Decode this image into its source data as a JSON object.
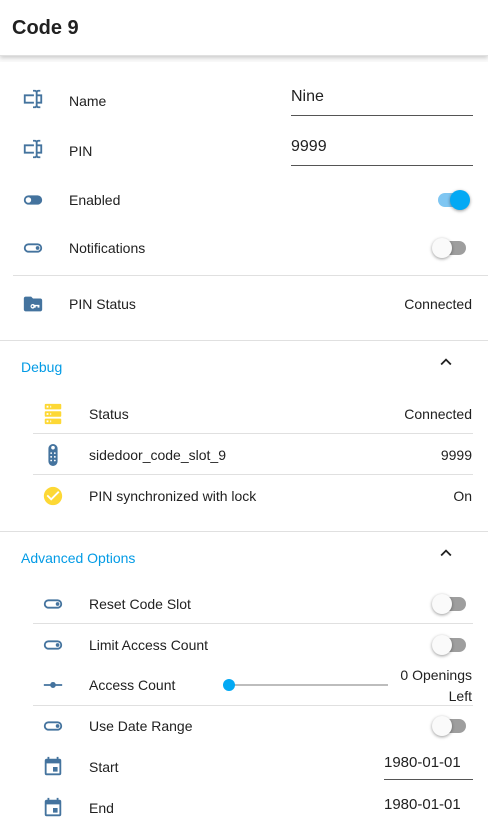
{
  "header": {
    "title": "Code 9"
  },
  "fields": [
    {
      "label": "Name",
      "value": "Nine"
    },
    {
      "label": "PIN",
      "value": "9999"
    }
  ],
  "switches": [
    {
      "label": "Enabled",
      "state": "on"
    },
    {
      "label": "Notifications",
      "state": "off"
    }
  ],
  "pin_status": {
    "label": "PIN Status",
    "value": "Connected"
  },
  "debug": {
    "title": "Debug",
    "rows": [
      {
        "label": "Status",
        "value": "Connected",
        "icon": "server-icon"
      },
      {
        "label": "sidedoor_code_slot_9",
        "value": "9999",
        "icon": "remote-icon"
      },
      {
        "label": "PIN synchronized with lock",
        "value": "On",
        "icon": "check-circle-icon"
      }
    ]
  },
  "advanced": {
    "title": "Advanced Options",
    "reset_code_slot": {
      "label": "Reset Code Slot",
      "state": "off"
    },
    "limit_access_count": {
      "label": "Limit Access Count",
      "state": "off"
    },
    "access_count": {
      "label": "Access Count",
      "value_line1": "0 Openings",
      "value_line2": "Left",
      "level": 0
    },
    "use_date_range": {
      "label": "Use Date Range",
      "state": "off"
    },
    "start": {
      "label": "Start",
      "value": "1980-01-01"
    },
    "end": {
      "label": "End",
      "value": "1980-01-01"
    }
  },
  "colors": {
    "accent": "#03a9f4",
    "section_title": "#039be5",
    "icon_default": "#44739e",
    "icon_active": "#fdd835"
  }
}
